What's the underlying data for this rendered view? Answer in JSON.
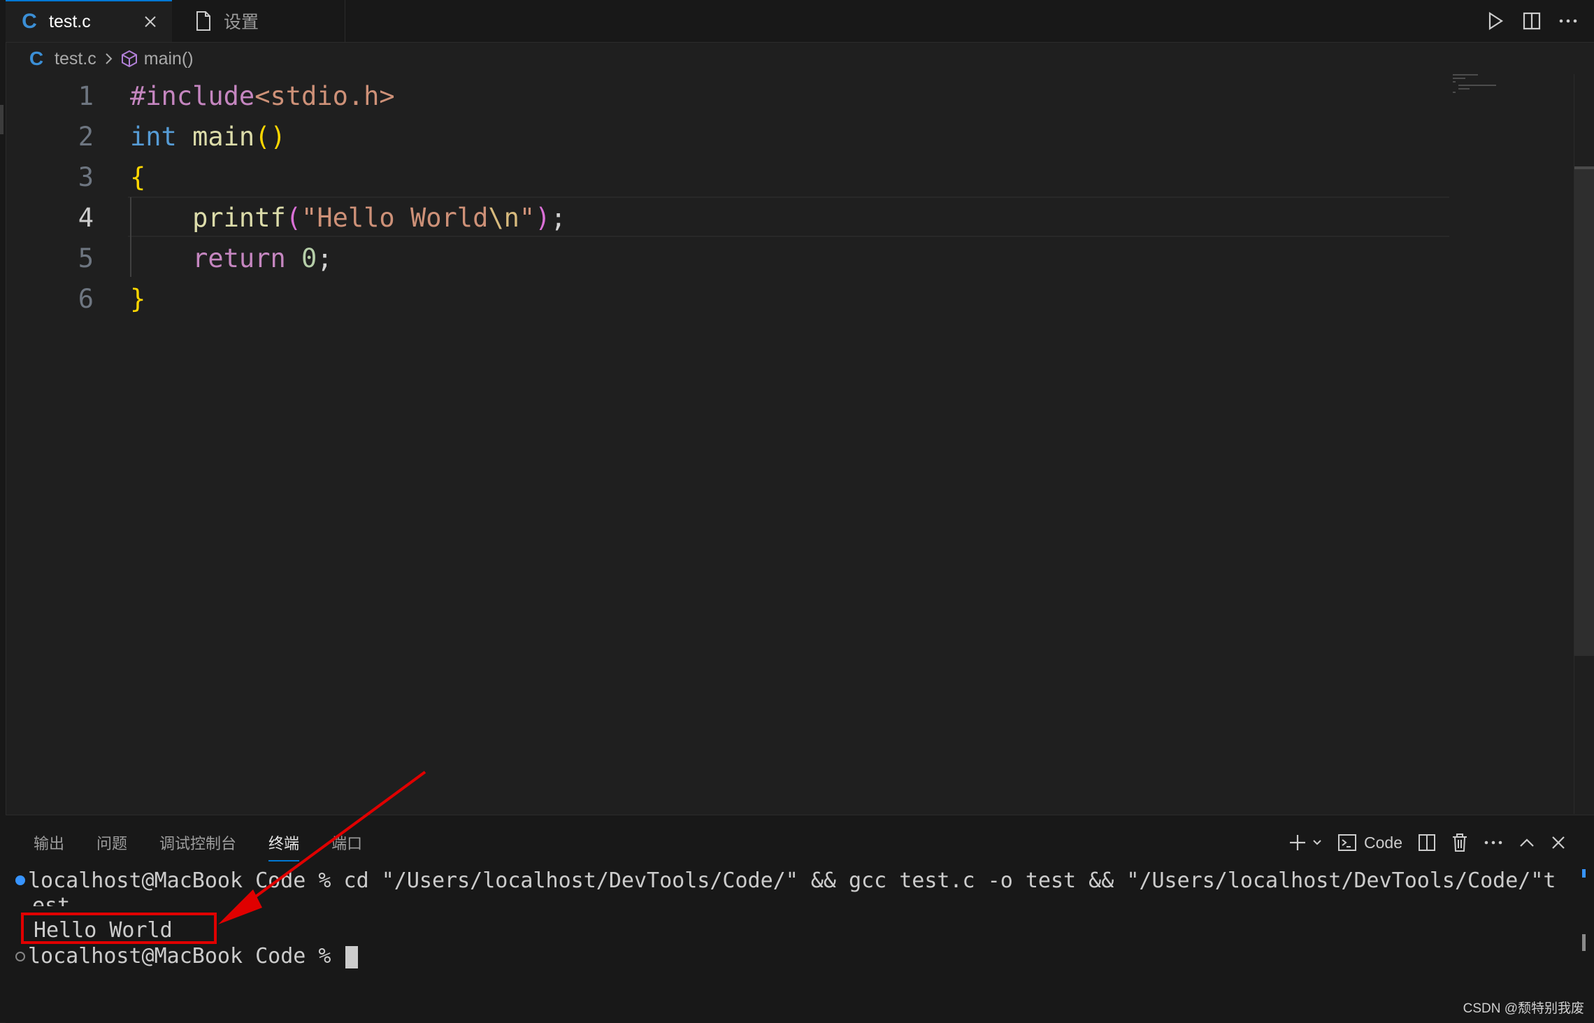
{
  "tabs": [
    {
      "label": "test.c",
      "icon": "c-file-icon",
      "glyph": "C",
      "active": true
    },
    {
      "label": "设置",
      "icon": "file-icon",
      "active": false
    }
  ],
  "breadcrumb": {
    "file": "test.c",
    "symbol": "main()",
    "glyph": "C"
  },
  "code_lines": [
    {
      "num": "1",
      "tokens": [
        {
          "c": "t-pp",
          "t": "#include"
        },
        {
          "c": "t-inc",
          "t": "<stdio.h>"
        }
      ]
    },
    {
      "num": "2",
      "tokens": [
        {
          "c": "t-kw",
          "t": "int"
        },
        {
          "c": "t-pl",
          "t": " "
        },
        {
          "c": "t-fn",
          "t": "main"
        },
        {
          "c": "t-br1",
          "t": "()"
        }
      ]
    },
    {
      "num": "3",
      "tokens": [
        {
          "c": "t-br1",
          "t": "{"
        }
      ]
    },
    {
      "num": "4",
      "tokens": [
        {
          "c": "t-pl",
          "t": "    "
        },
        {
          "c": "t-fn",
          "t": "printf"
        },
        {
          "c": "t-br2",
          "t": "("
        },
        {
          "c": "t-str",
          "t": "\"Hello World"
        },
        {
          "c": "t-esc",
          "t": "\\n"
        },
        {
          "c": "t-str",
          "t": "\""
        },
        {
          "c": "t-br2",
          "t": ")"
        },
        {
          "c": "t-pl",
          "t": ";"
        }
      ]
    },
    {
      "num": "5",
      "tokens": [
        {
          "c": "t-pl",
          "t": "    "
        },
        {
          "c": "t-ret",
          "t": "return"
        },
        {
          "c": "t-pl",
          "t": " "
        },
        {
          "c": "t-num",
          "t": "0"
        },
        {
          "c": "t-pl",
          "t": ";"
        }
      ]
    },
    {
      "num": "6",
      "tokens": [
        {
          "c": "t-br1",
          "t": "}"
        }
      ]
    }
  ],
  "current_line": "4",
  "panel": {
    "tabs": [
      "输出",
      "问题",
      "调试控制台",
      "终端",
      "端口"
    ],
    "active_tab": "终端",
    "terminal_name": "Code"
  },
  "terminal": {
    "line1": "localhost@MacBook Code % cd \"/Users/localhost/DevTools/Code/\" && gcc test.c -o test && \"/Users/localhost/DevTools/Code/\"t",
    "line1_wrap": "est",
    "output": "Hello World",
    "prompt": "localhost@MacBook Code % "
  },
  "watermark": "CSDN @颓特别我废",
  "colors": {
    "accent": "#0078d4",
    "annotation_red": "#e00000"
  }
}
